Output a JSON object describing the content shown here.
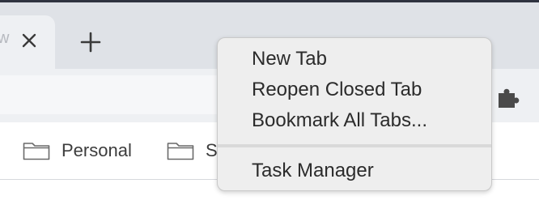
{
  "tabs": [
    {
      "title_fragment": "w"
    }
  ],
  "bookmarks": [
    {
      "label": "Personal"
    },
    {
      "label": "S"
    }
  ],
  "context_menu": {
    "items": [
      {
        "label": "New Tab"
      },
      {
        "label": "Reopen Closed Tab"
      },
      {
        "label": "Bookmark All Tabs..."
      },
      {
        "label": "Task Manager"
      }
    ]
  },
  "icons": {
    "tab_close": "close-icon",
    "new_tab": "plus-icon",
    "extensions": "puzzle-icon",
    "bookmark_folder": "folder-icon"
  },
  "colors": {
    "tabstrip_bg": "#dfe2e7",
    "toolbar_bg": "#eef0f3",
    "menu_bg": "#eeeeee"
  }
}
